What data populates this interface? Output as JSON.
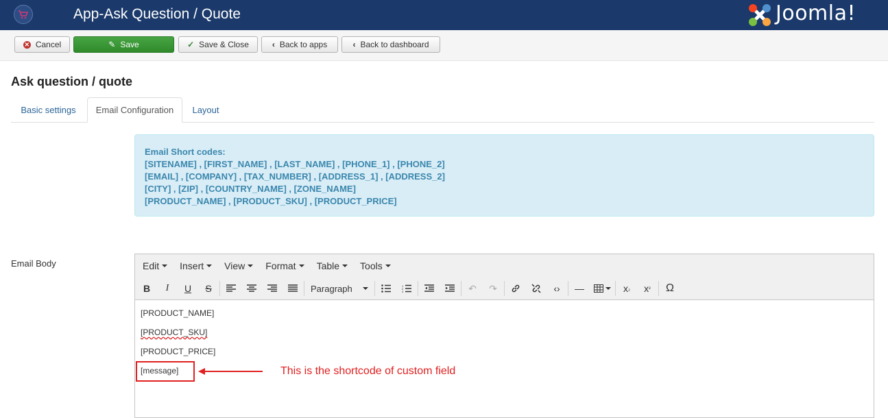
{
  "header": {
    "title": "App-Ask Question / Quote",
    "brand": "Joomla!"
  },
  "toolbar": {
    "cancel": "Cancel",
    "save": "Save",
    "save_close": "Save & Close",
    "back_apps": "Back to apps",
    "back_dashboard": "Back to dashboard"
  },
  "page": {
    "section_title": "Ask question / quote",
    "tabs": [
      "Basic settings",
      "Email Configuration",
      "Layout"
    ],
    "active_tab": "Email Configuration"
  },
  "info": {
    "heading": "Email Short codes:",
    "lines": [
      "[SITENAME] , [FIRST_NAME] , [LAST_NAME] , [PHONE_1] , [PHONE_2]",
      "[EMAIL] , [COMPANY] , [TAX_NUMBER] , [ADDRESS_1] , [ADDRESS_2]",
      "[CITY] , [ZIP] , [COUNTRY_NAME] , [ZONE_NAME]",
      "[PRODUCT_NAME] , [PRODUCT_SKU] , [PRODUCT_PRICE]"
    ]
  },
  "email_body": {
    "label": "Email Body",
    "menus": [
      "Edit",
      "Insert",
      "View",
      "Format",
      "Table",
      "Tools"
    ],
    "format_select": "Paragraph",
    "content_lines": [
      "[PRODUCT_NAME]",
      "[PRODUCT_SKU]",
      "[PRODUCT_PRICE]",
      "[message]"
    ]
  },
  "annotation": {
    "text": "This is the shortcode of custom field"
  },
  "colors": {
    "header_bg": "#1b3a6b",
    "save_green": "#378137",
    "info_bg": "#d9edf7",
    "info_text": "#3a87ad",
    "annotation_red": "#e02020"
  }
}
